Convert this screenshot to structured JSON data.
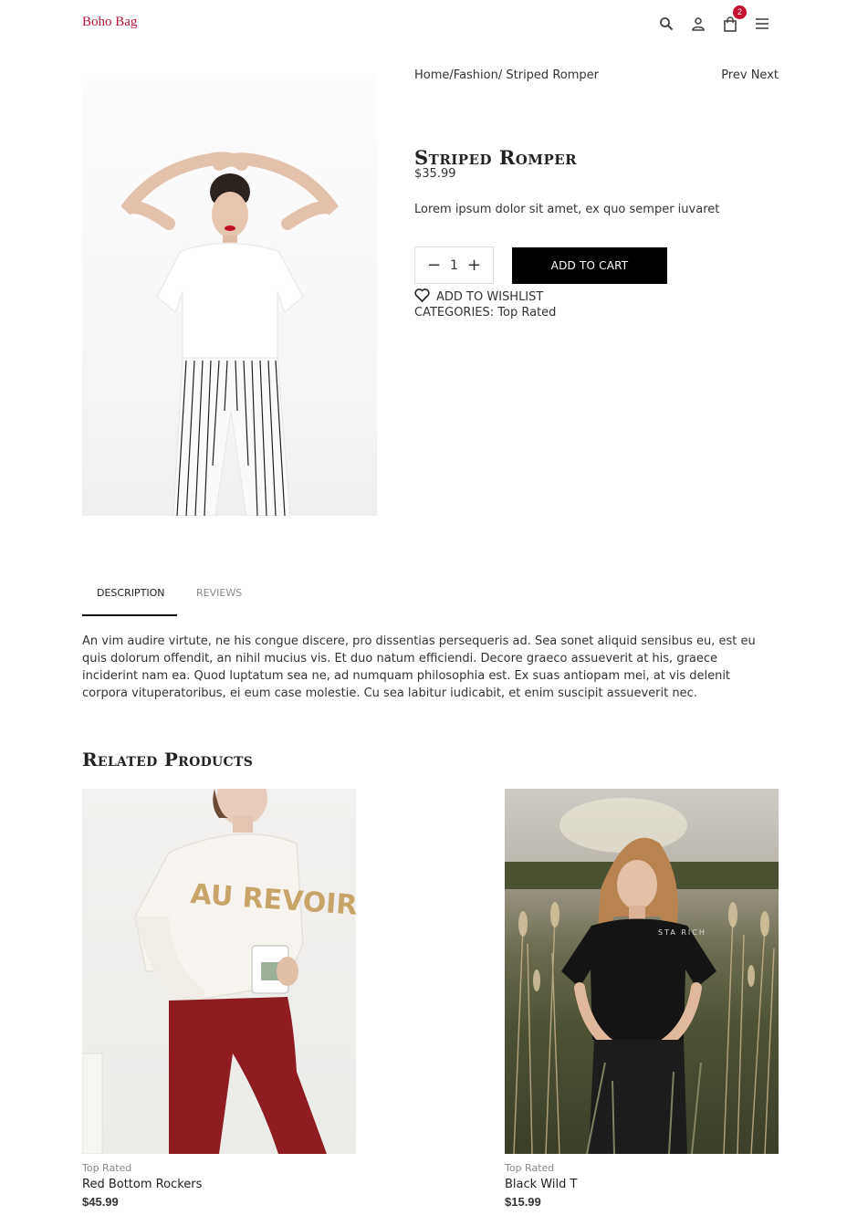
{
  "header": {
    "logo": "Boho Bag",
    "cart_count": "2",
    "icons": [
      "search-icon",
      "user-icon",
      "shopping-bag-icon",
      "menu-icon"
    ]
  },
  "breadcrumb": {
    "home": "Home",
    "sep1": "/",
    "category": "Fashion",
    "sep2": "/ ",
    "current": "Striped Romper"
  },
  "nav": {
    "prev": "Prev",
    "next": "Next"
  },
  "product": {
    "title": "Striped Romper",
    "price": "$35.99",
    "short_description": "Lorem ipsum dolor sit amet, ex quo semper iuvaret",
    "quantity": "1",
    "add_to_cart": "ADD TO CART",
    "wishlist": "ADD TO WISHLIST",
    "categories_label": "CATEGORIES: ",
    "category": "Top Rated"
  },
  "tabs": [
    {
      "label": "DESCRIPTION",
      "active": true
    },
    {
      "label": "REVIEWS",
      "active": false
    }
  ],
  "description": "An vim audire virtute, ne his congue discere, pro dissentias persequeris ad. Sea sonet aliquid sensibus eu, est eu quis dolorum offendit, an nihil mucius vis. Et duo natum efficiendi. Decore graeco assueverit at his, graece inciderint nam ea. Quod luptatum sea ne, ad numquam philosophia est. Ex suas antiopam mei, at vis delenit corpora vituperatoribus, ei eum case molestie. Cu sea labitur iudicabit, et enim suscipit assueverit nec.",
  "related": {
    "title": "Related Products",
    "items": [
      {
        "category": "Top Rated",
        "name": "Red Bottom Rockers",
        "price": "$45.99",
        "sweater_text": "AU REVOIR"
      },
      {
        "category": "Top Rated",
        "name": "Black Wild T",
        "price": "$15.99",
        "shirt_text": "STA RICH"
      }
    ]
  },
  "colors": {
    "brand": "#b8163a",
    "badge": "#c8102e",
    "button": "#000000"
  }
}
